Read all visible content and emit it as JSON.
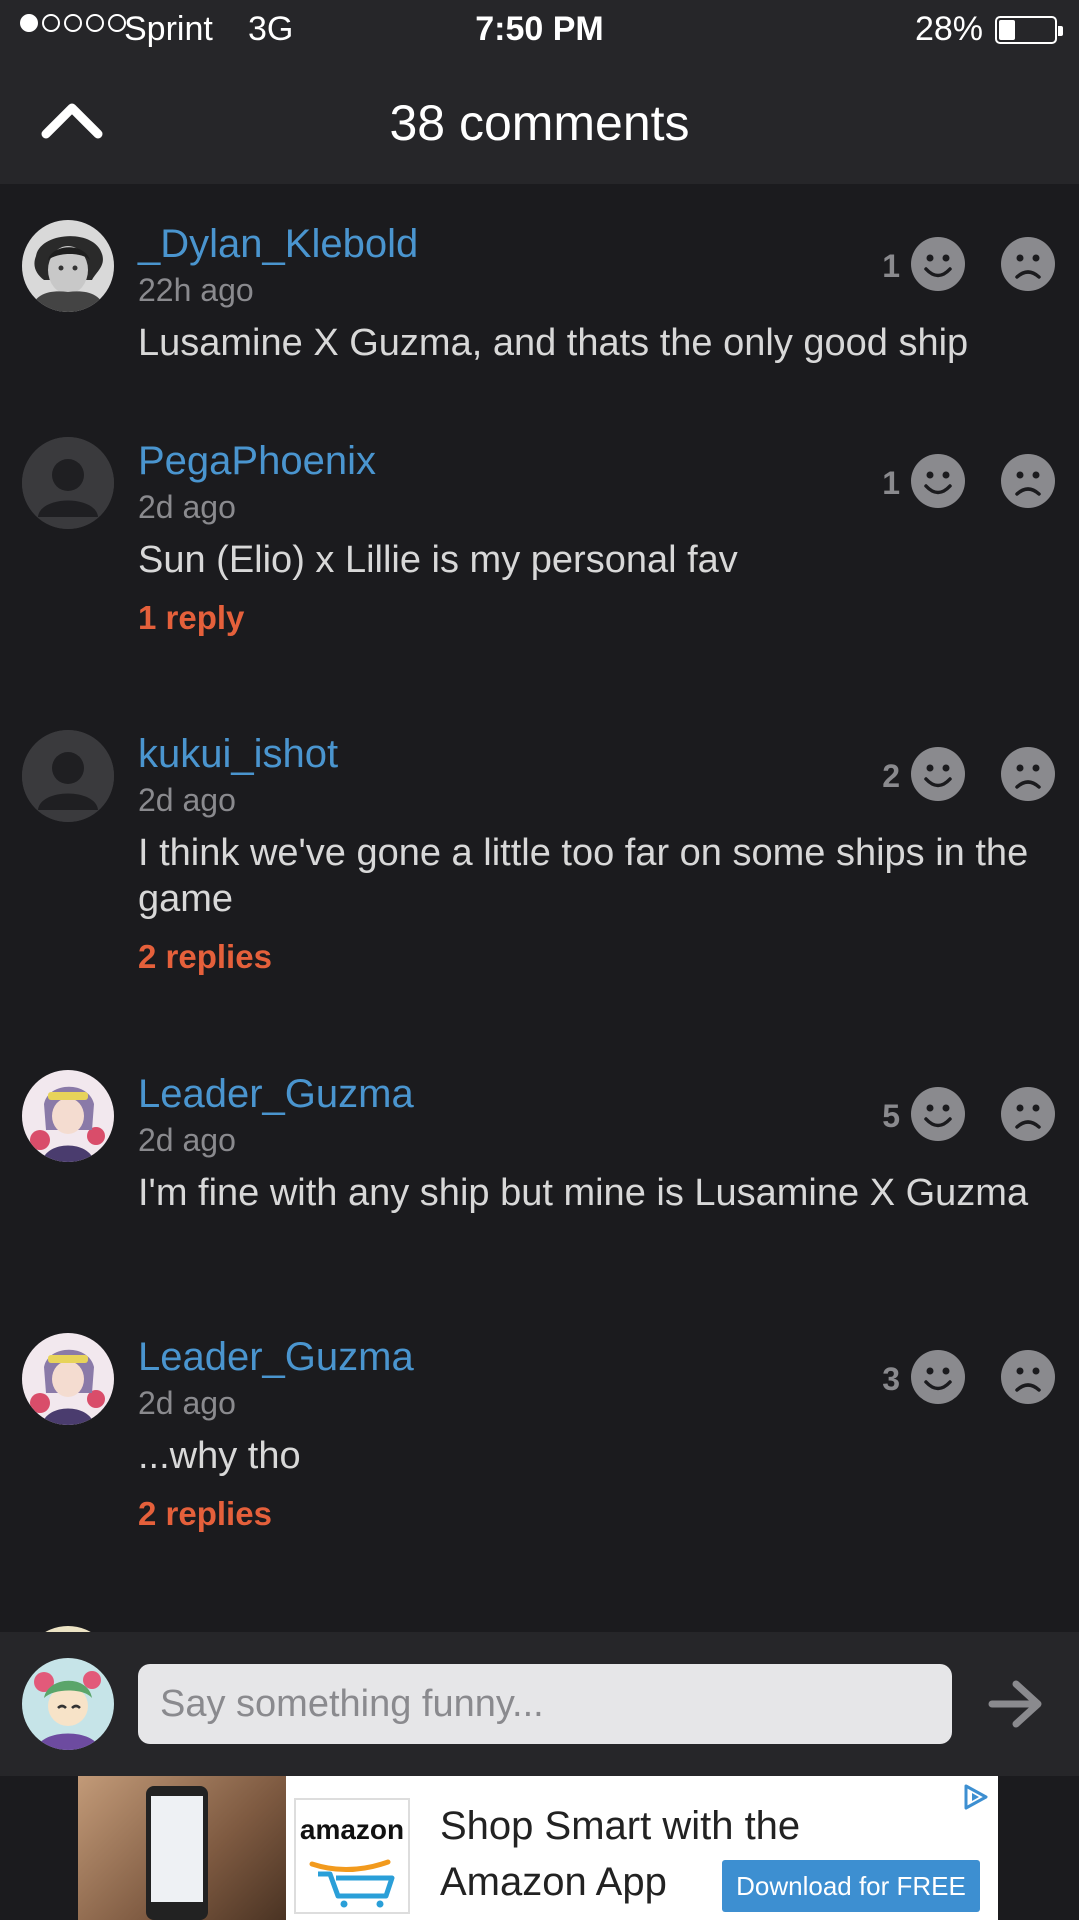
{
  "status_bar": {
    "carrier": "Sprint",
    "network": "3G",
    "time": "7:50 PM",
    "battery_percent": "28%",
    "signal_bars_filled": 1,
    "signal_bars_total": 5,
    "battery_level": 0.28
  },
  "header": {
    "title": "38 comments",
    "back_icon": "chevron-up-icon"
  },
  "comments": [
    {
      "username": "_Dylan_Klebold",
      "ago": "22h ago",
      "text": "Lusamine X Guzma, and thats the only good ship",
      "likes": "1",
      "replies": "",
      "avatar": "photo"
    },
    {
      "username": "PegaPhoenix",
      "ago": "2d ago",
      "text": "Sun (Elio) x Lillie is my personal fav",
      "likes": "1",
      "replies": "1 reply",
      "avatar": "default"
    },
    {
      "username": "kukui_ishot",
      "ago": "2d ago",
      "text": "I think we've gone a little too far on some ships in the game",
      "likes": "2",
      "replies": "2 replies",
      "avatar": "default"
    },
    {
      "username": "Leader_Guzma",
      "ago": "2d ago",
      "text": "I'm fine with any ship but mine is Lusamine X Guzma",
      "likes": "5",
      "replies": "",
      "avatar": "anime"
    },
    {
      "username": "Leader_Guzma",
      "ago": "2d ago",
      "text": "...why tho",
      "likes": "3",
      "replies": "2 replies",
      "avatar": "anime"
    }
  ],
  "composer": {
    "placeholder": "Say something funny...",
    "send_icon": "arrow-right-icon"
  },
  "ad": {
    "logo_text": "amazon",
    "headline_line1": "Shop Smart with the",
    "headline_line2": "Amazon App",
    "cta": "Download for FREE",
    "adchoices_icon": "adchoices-icon"
  },
  "colors": {
    "background": "#1b1b1e",
    "bar": "#262629",
    "username": "#4a95cf",
    "reply_link": "#e5603b",
    "muted": "#8a8a8e"
  }
}
